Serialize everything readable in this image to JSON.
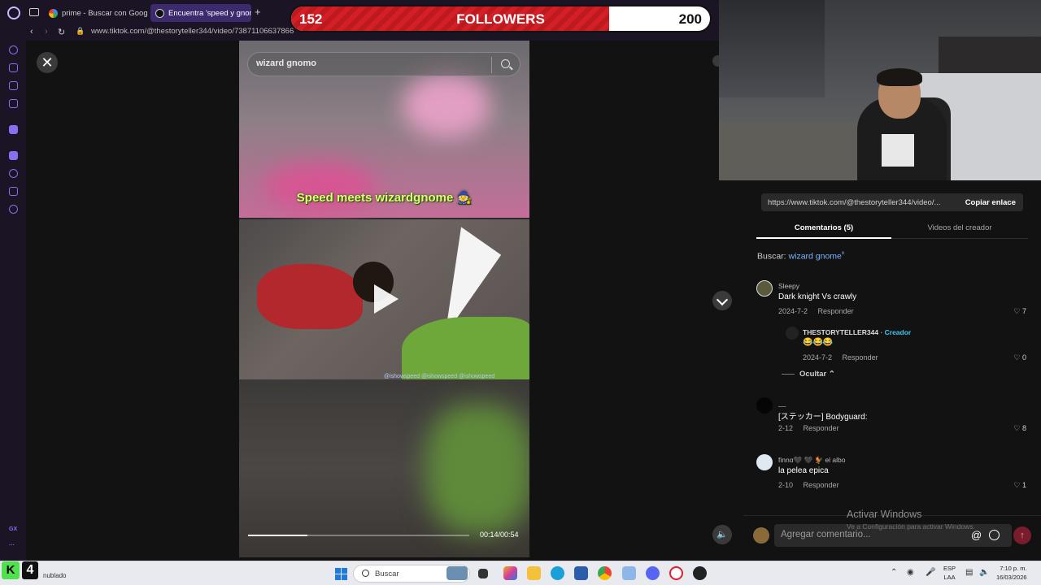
{
  "browser": {
    "tabs": [
      {
        "label": "prime - Buscar con Google"
      },
      {
        "label": "Encuentra 'speed y gnomo"
      }
    ],
    "new_tab": "+",
    "url": "www.tiktok.com/@thestoryteller344/video/73871106637866"
  },
  "video": {
    "search_value": "wizard gnomo",
    "caption": "Speed meets wizardgnome 🧙",
    "watermark": "@ishowspeed  @ishowspeed  @ishowspeed",
    "time": "00:14/00:54",
    "progress": 0.27
  },
  "followers": {
    "current": "152",
    "label": "FOLLOWERS",
    "goal": "200",
    "progress": 0.76
  },
  "panel": {
    "link_url": "https://www.tiktok.com/@thestoryteller344/video/...",
    "copy_label": "Copiar enlace",
    "tab_comments": "Comentarios (5)",
    "tab_creator_videos": "Videos del creador",
    "search_prefix": "Buscar:",
    "search_term": "wizard gnome",
    "search_icon": "ᵠ",
    "comments": [
      {
        "user": "Sleepy",
        "text": "Dark knight Vs crawly",
        "date": "2024-7-2",
        "reply": "Responder",
        "likes": "7"
      },
      {
        "user": "THESTORYTELLER344",
        "badge": "· Creador",
        "text": "😂😂😂",
        "date": "2024-7-2",
        "reply": "Responder",
        "likes": "0"
      },
      {
        "user": "__",
        "text": "[ステッカー] Bodyguard:",
        "date": "2-12",
        "reply": "Responder",
        "likes": "8"
      },
      {
        "user": "finnα🖤 🖤 🐓 el albo",
        "text": "la pelea epica",
        "date": "2-10",
        "reply": "Responder",
        "likes": "1"
      }
    ],
    "hide_label": "Ocultar ⌃",
    "comment_placeholder": "Agregar comentario...",
    "at_symbol": "@",
    "send_symbol": "↑"
  },
  "watermark_windows": {
    "title": "Activar Windows",
    "subtitle": "Ve a Configuración para activar Windows."
  },
  "taskbar": {
    "kick_logo": "K",
    "kick_count": "4",
    "weather": "nublado",
    "search_placeholder": "Buscar",
    "lang_top": "ESP",
    "lang_bottom": "LAA",
    "time": "7:10 p. m.",
    "date": "16/03/2026"
  }
}
